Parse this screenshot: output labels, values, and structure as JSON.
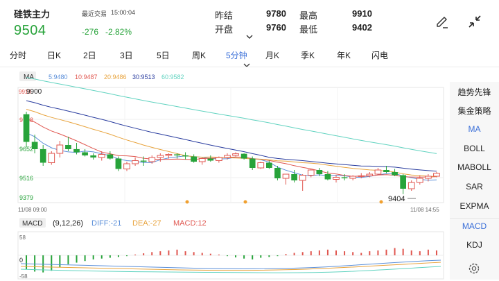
{
  "header": {
    "name": "硅铁主力",
    "trade_label": "最近交易",
    "trade_time": "15:00:04",
    "price": "9504",
    "change": "-276",
    "change_pct": "-2.82%"
  },
  "quote": {
    "prev_close_label": "昨结",
    "prev_close": "9780",
    "high_label": "最高",
    "high": "9910",
    "open_label": "开盘",
    "open": "9760",
    "low_label": "最低",
    "low": "9402"
  },
  "tabs": [
    {
      "label": "分时"
    },
    {
      "label": "日K"
    },
    {
      "label": "2日"
    },
    {
      "label": "3日"
    },
    {
      "label": "5日"
    },
    {
      "label": "周K"
    },
    {
      "label": "5分钟",
      "active": true
    },
    {
      "label": "月K"
    },
    {
      "label": "季K"
    },
    {
      "label": "年K"
    },
    {
      "label": "闪电"
    }
  ],
  "ma_legend": {
    "badge": "MA",
    "items": [
      {
        "text": "5:9480",
        "color": "#5b8fd9"
      },
      {
        "text": "10:9487",
        "color": "#e0564f"
      },
      {
        "text": "20:9486",
        "color": "#e8a33c"
      },
      {
        "text": "30:9513",
        "color": "#283b9e"
      },
      {
        "text": "60:9582",
        "color": "#61d3c0"
      }
    ]
  },
  "price_axis": {
    "top_label_red": "9910",
    "top_label": "9900",
    "labels": [
      "9788",
      "9652",
      "9516",
      "9379"
    ]
  },
  "time_axis": {
    "start": "11/08 09:00",
    "end": "11/08 14:55"
  },
  "low_marker": "9404",
  "macd": {
    "badge": "MACD",
    "params": "(9,12,26)",
    "diff_label": "DIFF:-21",
    "dea_label": "DEA:-27",
    "macd_label": "MACD:12",
    "axis": [
      "58",
      "0",
      "-58"
    ]
  },
  "right_panel": [
    {
      "label": "趋势先锋"
    },
    {
      "label": "集金策略"
    },
    {
      "label": "MA",
      "active": true
    },
    {
      "label": "BOLL"
    },
    {
      "label": "MABOLL"
    },
    {
      "label": "SAR"
    },
    {
      "label": "EXPMA"
    },
    {
      "label": "MACD",
      "active": true
    },
    {
      "label": "KDJ"
    }
  ],
  "colors": {
    "up": "#e0564f",
    "down": "#27a33a",
    "ma5": "#5b8fd9",
    "ma10": "#e0564f",
    "ma20": "#e8a33c",
    "ma30": "#283b9e",
    "ma60": "#61d3c0",
    "active": "#3a6fd8"
  },
  "candles": [
    [
      9788,
      9800,
      9630,
      9655
    ],
    [
      9655,
      9690,
      9600,
      9620
    ],
    [
      9620,
      9640,
      9540,
      9555
    ],
    [
      9555,
      9610,
      9545,
      9600
    ],
    [
      9600,
      9660,
      9580,
      9640
    ],
    [
      9640,
      9680,
      9610,
      9620
    ],
    [
      9620,
      9650,
      9595,
      9605
    ],
    [
      9605,
      9620,
      9585,
      9590
    ],
    [
      9590,
      9600,
      9570,
      9580
    ],
    [
      9580,
      9610,
      9565,
      9595
    ],
    [
      9595,
      9610,
      9570,
      9575
    ],
    [
      9575,
      9585,
      9515,
      9525
    ],
    [
      9525,
      9560,
      9515,
      9550
    ],
    [
      9550,
      9580,
      9540,
      9565
    ],
    [
      9565,
      9585,
      9540,
      9560
    ],
    [
      9560,
      9590,
      9550,
      9580
    ],
    [
      9580,
      9600,
      9560,
      9590
    ],
    [
      9590,
      9600,
      9575,
      9595
    ],
    [
      9595,
      9600,
      9575,
      9590
    ],
    [
      9590,
      9605,
      9570,
      9585
    ],
    [
      9585,
      9595,
      9555,
      9560
    ],
    [
      9560,
      9580,
      9545,
      9575
    ],
    [
      9575,
      9590,
      9560,
      9565
    ],
    [
      9565,
      9585,
      9555,
      9580
    ],
    [
      9580,
      9600,
      9570,
      9590
    ],
    [
      9590,
      9605,
      9585,
      9598
    ],
    [
      9598,
      9600,
      9570,
      9575
    ],
    [
      9575,
      9585,
      9520,
      9530
    ],
    [
      9530,
      9560,
      9525,
      9555
    ],
    [
      9555,
      9565,
      9525,
      9530
    ],
    [
      9530,
      9540,
      9470,
      9480
    ],
    [
      9480,
      9500,
      9450,
      9500
    ],
    [
      9500,
      9520,
      9460,
      9470
    ],
    [
      9470,
      9500,
      9420,
      9495
    ],
    [
      9495,
      9525,
      9485,
      9520
    ],
    [
      9520,
      9530,
      9490,
      9500
    ],
    [
      9500,
      9515,
      9470,
      9475
    ],
    [
      9475,
      9495,
      9460,
      9485
    ],
    [
      9485,
      9500,
      9470,
      9480
    ],
    [
      9480,
      9495,
      9470,
      9490
    ],
    [
      9490,
      9505,
      9480,
      9492
    ],
    [
      9492,
      9510,
      9485,
      9500
    ],
    [
      9500,
      9530,
      9495,
      9520
    ],
    [
      9520,
      9540,
      9505,
      9510
    ],
    [
      9510,
      9525,
      9490,
      9495
    ],
    [
      9495,
      9500,
      9404,
      9430
    ],
    [
      9430,
      9470,
      9420,
      9460
    ],
    [
      9460,
      9495,
      9450,
      9480
    ],
    [
      9480,
      9500,
      9465,
      9490
    ],
    [
      9490,
      9510,
      9485,
      9504
    ]
  ],
  "macd_hist": [
    -35,
    -40,
    -42,
    -38,
    -30,
    -22,
    -18,
    -14,
    -10,
    -8,
    -6,
    -4,
    -2,
    2,
    5,
    8,
    10,
    12,
    14,
    10,
    8,
    6,
    4,
    2,
    -2,
    -5,
    -8,
    -10,
    -6,
    -4,
    -2,
    3,
    6,
    8,
    10,
    12,
    14,
    12,
    10,
    8,
    6,
    10,
    12,
    14,
    18,
    16,
    12,
    10,
    14,
    12
  ]
}
